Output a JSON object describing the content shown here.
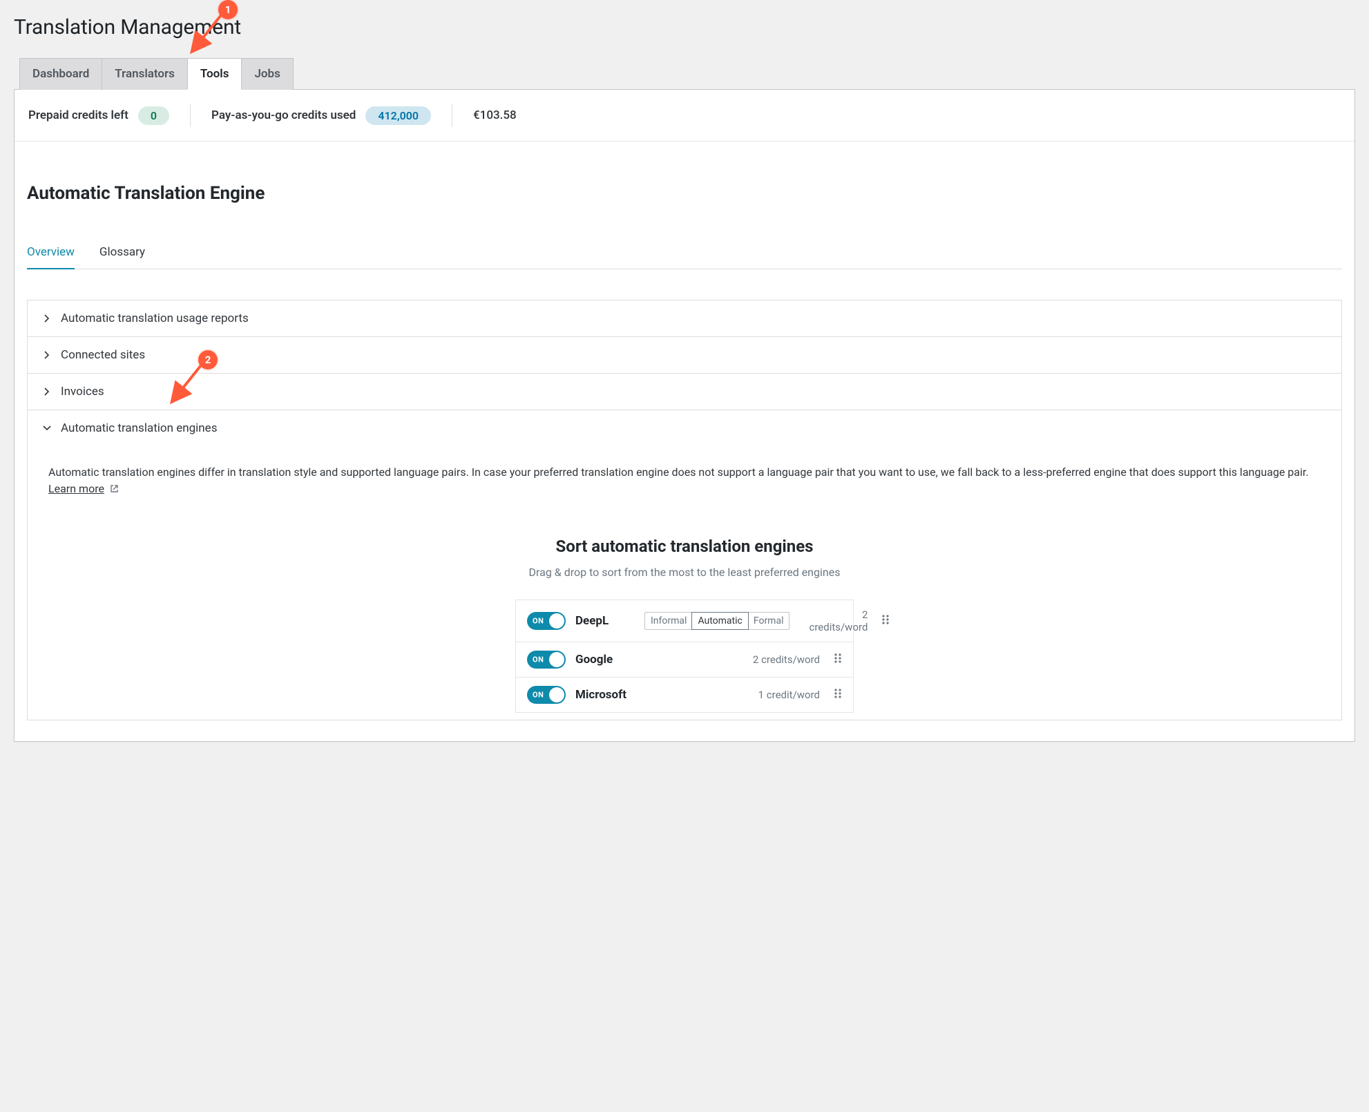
{
  "page_title": "Translation Management",
  "tabs": {
    "dashboard": "Dashboard",
    "translators": "Translators",
    "tools": "Tools",
    "jobs": "Jobs"
  },
  "credits": {
    "prepaid_label": "Prepaid credits left",
    "prepaid_value": "0",
    "payg_label": "Pay-as-you-go credits used",
    "payg_value": "412,000",
    "amount": "€103.58"
  },
  "section_title": "Automatic Translation Engine",
  "subtabs": {
    "overview": "Overview",
    "glossary": "Glossary"
  },
  "accordion": {
    "usage_reports": "Automatic translation usage reports",
    "connected_sites": "Connected sites",
    "invoices": "Invoices",
    "engines": "Automatic translation engines"
  },
  "engines_panel": {
    "description": "Automatic translation engines differ in translation style and supported language pairs. In case your preferred translation engine does not support a language pair that you want to use, we fall back to a less-preferred engine that does support this language pair.",
    "learn_more": "Learn more",
    "sort_title": "Sort automatic translation engines",
    "sort_subtitle": "Drag & drop to sort from the most to the least preferred engines",
    "toggle_on": "ON",
    "formality": {
      "informal": "Informal",
      "automatic": "Automatic",
      "formal": "Formal"
    },
    "rows": [
      {
        "name": "DeepL",
        "cost": "2 credits/word"
      },
      {
        "name": "Google",
        "cost": "2 credits/word"
      },
      {
        "name": "Microsoft",
        "cost": "1 credit/word"
      }
    ]
  },
  "annotations": {
    "one": "1",
    "two": "2"
  }
}
